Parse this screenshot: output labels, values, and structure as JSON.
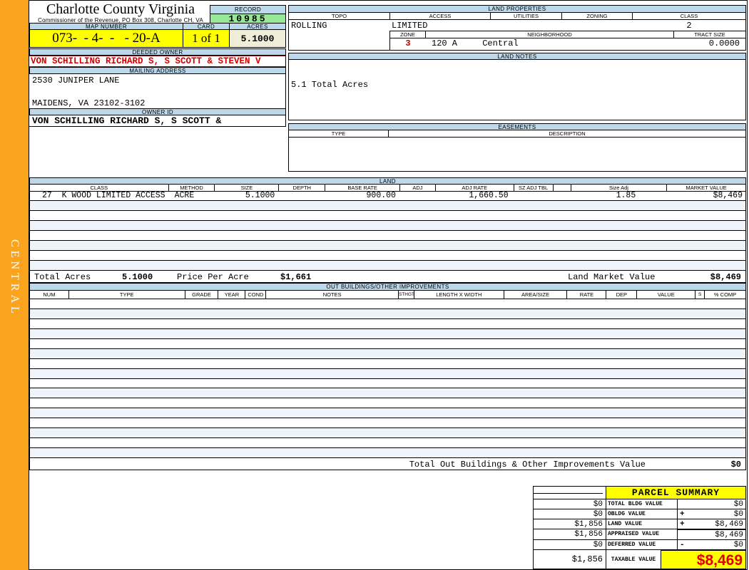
{
  "sidebar": {
    "label": "CENTRAL"
  },
  "header": {
    "county": "Charlotte County Virginia",
    "commissioner_line": "Commissioner of the Revenue, PO Box 308, Charlotte CH, VA",
    "record_label": "RECORD",
    "record_value": "10985",
    "map_number_label": "MAP NUMBER",
    "map_number_value": "073-  - 4-  -   - 20-A",
    "card_label": "CARD",
    "card_value": "1 of 1",
    "acres_label": "ACRES",
    "acres_value": "5.1000"
  },
  "owner": {
    "deeded_owner_label": "DEEDED OWNER",
    "deeded_owner_value": "VON SCHILLING RICHARD S, S SCOTT & STEVEN V",
    "mailing_address_label": "MAILING ADDRESS",
    "address_line1": "2530 JUNIPER LANE",
    "address_line2": "MAIDENS, VA 23102-3102",
    "owner_id_label": "OWNER ID",
    "owner_id_value": "VON SCHILLING RICHARD S, S SCOTT &"
  },
  "land_properties": {
    "title": "LAND PROPERTIES",
    "columns": [
      "TOPO",
      "ACCESS",
      "UTILITIES",
      "ZONING",
      "CLASS"
    ],
    "topo": "ROLLING",
    "access": "LIMITED",
    "utilities": "",
    "zoning": "",
    "class": "2",
    "zone_label": "ZONE",
    "zone_value": "3",
    "neighborhood_label": "NEIGHBORHOOD",
    "neighborhood_code": "120 A",
    "neighborhood_name": "Central",
    "tract_size_label": "TRACT SIZE",
    "tract_size_value": "0.0000"
  },
  "land_notes": {
    "title": "LAND NOTES",
    "note": "5.1 Total Acres"
  },
  "easements": {
    "title": "EASEMENTS",
    "type_label": "TYPE",
    "description_label": "DESCRIPTION"
  },
  "land": {
    "title": "LAND",
    "columns": [
      "CLASS",
      "METHOD",
      "SIZE",
      "DEPTH",
      "BASE RATE",
      "ADJ",
      "ADJ RATE",
      "SZ ADJ TBL",
      "",
      "Size Adj",
      "MARKET VALUE"
    ],
    "row": {
      "class": "27  K WOOD LIMITED ACCESS",
      "method": "ACRE",
      "size": "5.1000",
      "depth": "",
      "base_rate": "900.00",
      "adj": "",
      "adj_rate": "1,660.50",
      "sz_adj_tbl": "",
      "size_adj": "1.85",
      "market_value": "$8,469"
    },
    "totals": {
      "total_acres_label": "Total Acres",
      "total_acres": "5.1000",
      "price_per_acre_label": "Price Per Acre",
      "price_per_acre": "$1,661",
      "land_market_value_label": "Land Market Value",
      "land_market_value": "$8,469"
    }
  },
  "out_buildings": {
    "title": "OUT BUILDINGS/OTHER IMPROVEMENTS",
    "columns": [
      "NUM",
      "TYPE",
      "GRADE",
      "YEAR",
      "COND",
      "NOTES",
      "STHGT",
      "LENGTH X WIDTH",
      "AREA/SIZE",
      "RATE",
      "DEP",
      "VALUE",
      "S",
      "% COMP"
    ],
    "total_label": "Total Out Buildings & Other Improvements Value",
    "total_value": "$0"
  },
  "parcel_summary": {
    "title": "PARCEL SUMMARY",
    "rows": [
      {
        "prior": "$0",
        "label": "TOTAL BLDG VALUE",
        "op": "",
        "value": "$0"
      },
      {
        "prior": "$0",
        "label": "OBLDG VALUE",
        "op": "+",
        "value": "$0"
      },
      {
        "prior": "$1,856",
        "label": "LAND VALUE",
        "op": "+",
        "value": "$8,469"
      },
      {
        "prior": "$1,856",
        "label": "APPRAISED VALUE",
        "op": "",
        "value": "$8,469"
      },
      {
        "prior": "$0",
        "label": "DEFERRED VALUE",
        "op": "-",
        "value": "$0"
      }
    ],
    "taxable": {
      "prior": "$1,856",
      "label": "TAXABLE VALUE",
      "value": "$8,469"
    }
  },
  "colors": {
    "label_bar_blue": "#BDD8EA",
    "highlight_yellow": "#FFFF00",
    "record_green": "#98E898",
    "acres_cream": "#F0EDD8",
    "sidebar_orange": "#FAA41E",
    "owner_red": "#D40000",
    "taxable_red": "#E00000"
  }
}
